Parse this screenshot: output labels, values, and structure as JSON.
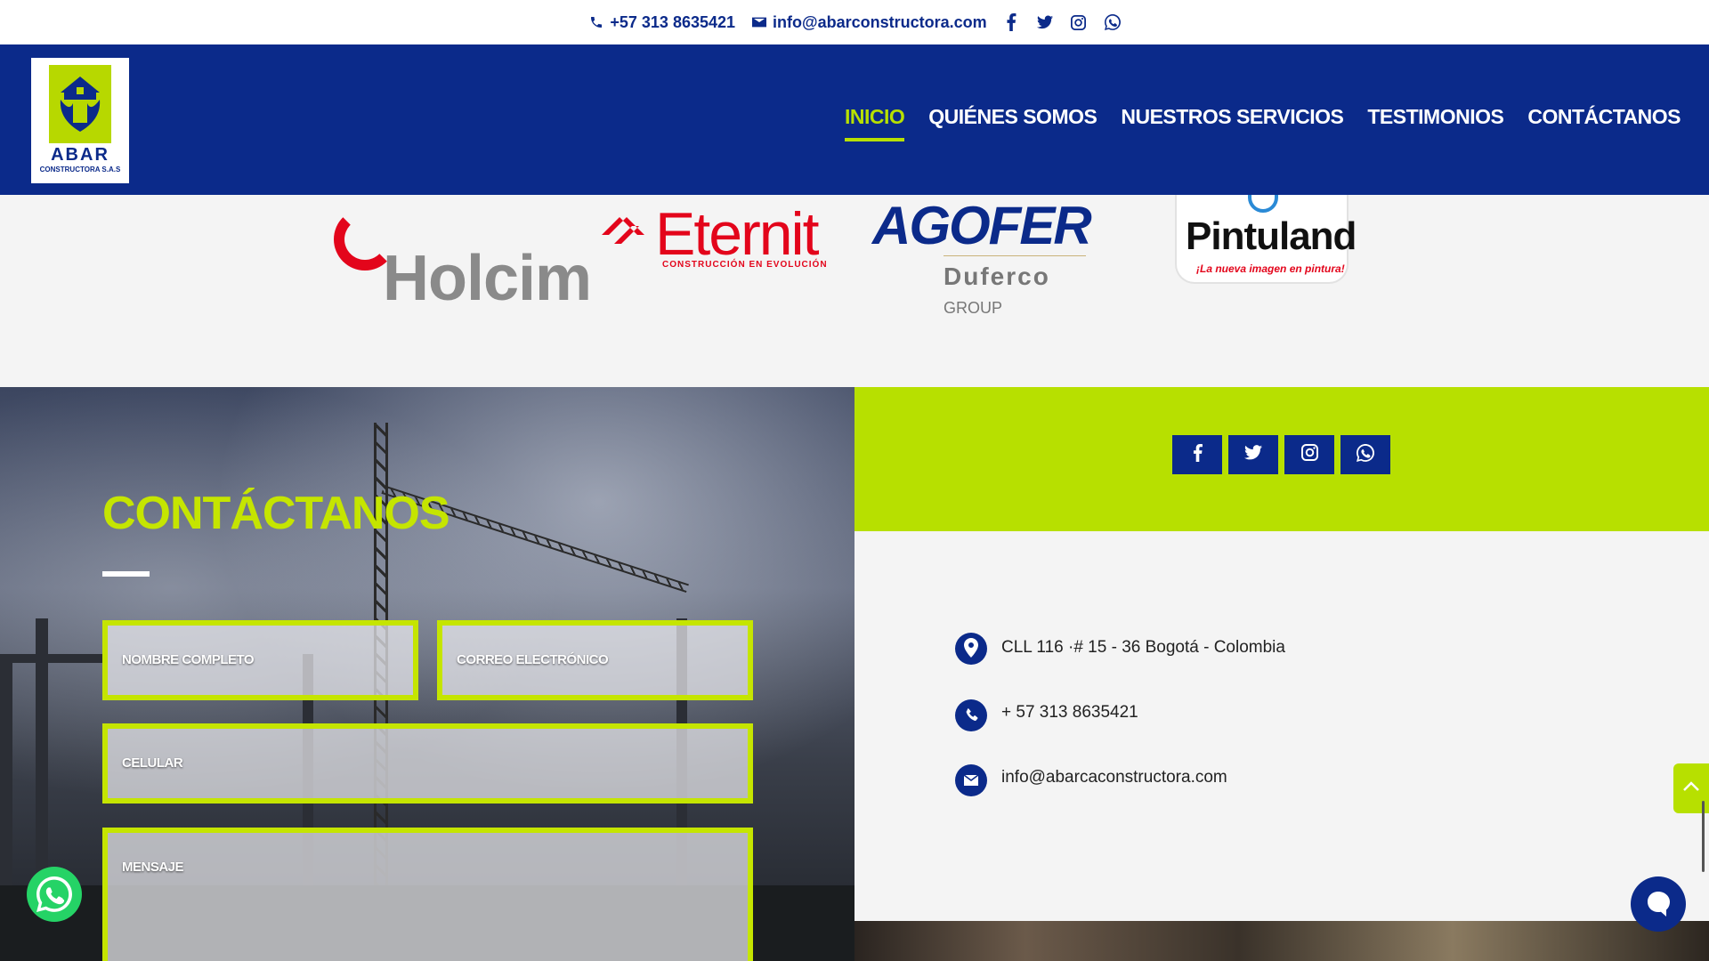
{
  "topbar": {
    "phone": "+57 313 8635421",
    "email": "info@abarconstructora.com",
    "social": [
      "facebook-icon",
      "twitter-icon",
      "instagram-icon",
      "whatsapp-icon"
    ]
  },
  "header": {
    "logo": {
      "name": "ABAR",
      "subtitle": "CONSTRUCTORA S.A.S"
    },
    "nav": [
      {
        "label": "INICIO",
        "active": true
      },
      {
        "label": "QUIÉNES SOMOS",
        "active": false
      },
      {
        "label": "NUESTROS SERVICIOS",
        "active": false
      },
      {
        "label": "TESTIMONIOS",
        "active": false
      },
      {
        "label": "CONTÁCTANOS",
        "active": false
      }
    ]
  },
  "brands": {
    "holcim": "Holcim",
    "eternit": {
      "name": "Eternit",
      "tagline": "CONSTRUCCIÓN EN EVOLUCIÓN"
    },
    "agofer": {
      "name": "AGOFER",
      "group": "Duferco",
      "group_suffix": "GROUP"
    },
    "pintuland": {
      "name": "Pintuland",
      "tagline": "¡La nueva imagen en pintura!"
    }
  },
  "contact": {
    "title": "CONTÁCTANOS",
    "fields": {
      "name": "NOMBRE COMPLETO",
      "email": "CORREO ELECTRÓNICO",
      "phone": "CELULAR",
      "message": "MENSAJE"
    },
    "social_buttons": [
      "facebook-icon",
      "twitter-icon",
      "instagram-icon",
      "whatsapp-icon"
    ],
    "address": "CLL 116 ·# 15 - 36 Bogotá - Colombia",
    "phone": "+ 57 313 8635421",
    "email": "info@abarcaconstructora.com"
  },
  "colors": {
    "primary_blue": "#0b2a8a",
    "accent_lime": "#b7e000",
    "whatsapp_green": "#25d366"
  }
}
